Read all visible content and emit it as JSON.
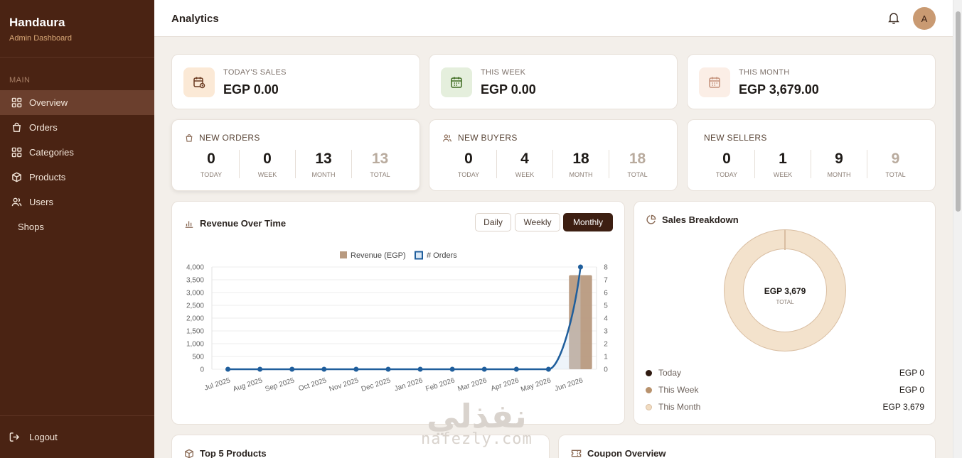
{
  "sidebar": {
    "title": "Handaura",
    "subtitle": "Admin Dashboard",
    "section_label": "MAIN",
    "items": [
      {
        "label": "Overview",
        "icon": "grid-icon"
      },
      {
        "label": "Orders",
        "icon": "bag-icon"
      },
      {
        "label": "Categories",
        "icon": "grid-icon"
      },
      {
        "label": "Products",
        "icon": "box-icon"
      },
      {
        "label": "Users",
        "icon": "users-icon"
      },
      {
        "label": "Shops",
        "icon": ""
      }
    ],
    "logout_label": "Logout"
  },
  "header": {
    "title": "Analytics",
    "avatar_initial": "A"
  },
  "kpis": [
    {
      "label": "TODAY'S SALES",
      "value": "EGP 0.00"
    },
    {
      "label": "THIS WEEK",
      "value": "EGP 0.00"
    },
    {
      "label": "THIS MONTH",
      "value": "EGP 3,679.00"
    }
  ],
  "stats": [
    {
      "title": "NEW ORDERS",
      "values": [
        "0",
        "0",
        "13",
        "13"
      ]
    },
    {
      "title": "NEW BUYERS",
      "values": [
        "0",
        "4",
        "18",
        "18"
      ]
    },
    {
      "title": "NEW SELLERS",
      "values": [
        "0",
        "1",
        "9",
        "9"
      ]
    }
  ],
  "stat_captions": [
    "TODAY",
    "WEEK",
    "MONTH",
    "TOTAL"
  ],
  "revenue": {
    "title": "Revenue Over Time",
    "buttons": [
      "Daily",
      "Weekly",
      "Monthly"
    ],
    "active_button": "Monthly"
  },
  "chart_data": {
    "type": "bar",
    "categories": [
      "Jul 2025",
      "Aug 2025",
      "Sep 2025",
      "Oct 2025",
      "Nov 2025",
      "Dec 2025",
      "Jan 2026",
      "Feb 2026",
      "Mar 2026",
      "Apr 2026",
      "May 2026",
      "Jun 2026"
    ],
    "series": [
      {
        "name": "Revenue (EGP)",
        "type": "bar",
        "axis": "left",
        "color": "#b89a80",
        "values": [
          0,
          0,
          0,
          0,
          0,
          0,
          0,
          0,
          0,
          0,
          0,
          3679
        ]
      },
      {
        "name": "# Orders",
        "type": "line",
        "axis": "right",
        "color": "#1f5e9c",
        "values": [
          0,
          0,
          0,
          0,
          0,
          0,
          0,
          0,
          0,
          0,
          0,
          8
        ]
      }
    ],
    "y_left": {
      "min": 0,
      "max": 4000,
      "ticks": [
        "0",
        "500",
        "1,000",
        "1,500",
        "2,000",
        "2,500",
        "3,000",
        "3,500",
        "4,000"
      ]
    },
    "y_right": {
      "min": 0,
      "max": 8,
      "ticks": [
        "0",
        "1",
        "2",
        "3",
        "4",
        "5",
        "6",
        "7",
        "8"
      ]
    },
    "grid": true,
    "legend": "top"
  },
  "breakdown": {
    "title": "Sales Breakdown",
    "center_value": "EGP 3,679",
    "center_caption": "TOTAL",
    "items": [
      {
        "label": "Today",
        "value": "EGP 0",
        "color": "#2f1a10"
      },
      {
        "label": "This Week",
        "value": "EGP 0",
        "color": "#b8926d"
      },
      {
        "label": "This Month",
        "value": "EGP 3,679",
        "color": "#f1dcc1"
      }
    ]
  },
  "bottom": {
    "top_products_title": "Top 5 Products",
    "coupon_title": "Coupon Overview"
  },
  "watermark": {
    "arabic": "نفذلي",
    "latin": "nafezly.com"
  }
}
